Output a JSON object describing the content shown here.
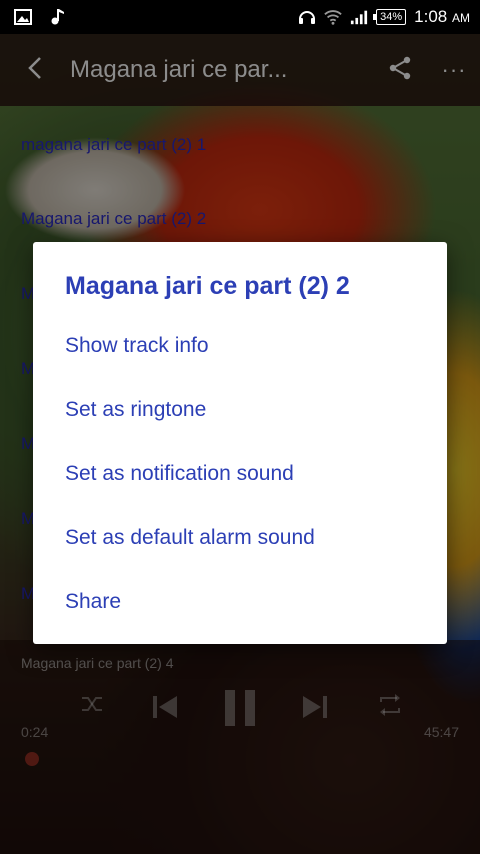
{
  "status_bar": {
    "battery": "34%",
    "time": "1:08",
    "ampm": "AM"
  },
  "app_bar": {
    "title": "Magana jari ce par..."
  },
  "track_list": [
    "magana jari ce part (2) 1",
    "Magana jari ce part (2) 2",
    "M",
    "M",
    "M",
    "M",
    "M"
  ],
  "player": {
    "now_playing": "Magana jari ce part (2) 4",
    "elapsed": "0:24",
    "duration": "45:47"
  },
  "dialog": {
    "title": "Magana jari ce part (2) 2",
    "items": [
      "Show track info",
      "Set as ringtone",
      "Set as notification sound",
      "Set as default alarm sound",
      "Share"
    ]
  },
  "colors": {
    "accent": "#2c3fb5",
    "list_text": "#2a2bc8"
  }
}
